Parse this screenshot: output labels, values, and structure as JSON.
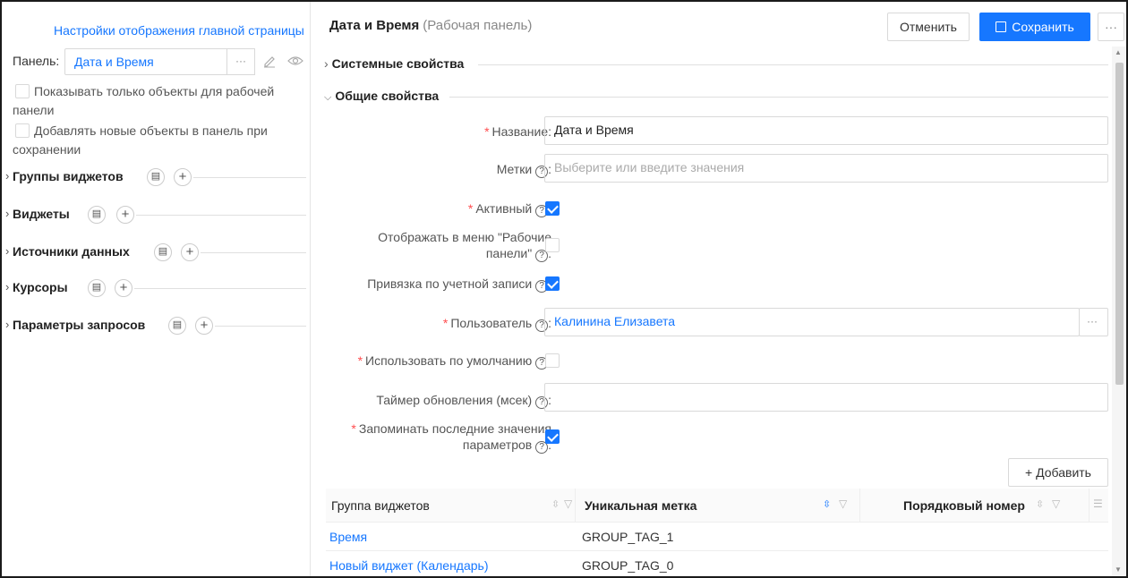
{
  "left": {
    "title": "Настройки отображения главной страницы",
    "panel_label": "Панель:",
    "panel_value": "Дата и Время",
    "panel_dots": "···",
    "options": [
      {
        "label": "Показывать только объекты для рабочей панели",
        "checked": false
      },
      {
        "label": "Добавлять новые объекты в панель при сохранении",
        "checked": false
      }
    ],
    "sections": [
      {
        "name": "Группы виджетов"
      },
      {
        "name": "Виджеты"
      },
      {
        "name": "Источники данных"
      },
      {
        "name": "Курсоры"
      },
      {
        "name": "Параметры запросов"
      }
    ]
  },
  "header": {
    "title": "Дата и Время",
    "subtitle": "(Рабочая панель)",
    "cancel_label": "Отменить",
    "save_label": "Сохранить",
    "more_label": "···"
  },
  "groups": {
    "system": "Системные свойства",
    "general": "Общие свойства"
  },
  "form": {
    "name_label": "Название:",
    "name_value": "Дата и Время",
    "tags_label": "Метки",
    "tags_placeholder": "Выберите или введите значения",
    "active_label": "Активный",
    "show_menu_label_1": "Отображать в меню \"Рабочие",
    "show_menu_label_2": "панели\"",
    "bind_account_label": "Привязка по учетной записи",
    "user_label": "Пользователь",
    "user_value": "Калинина Елизавета",
    "user_dots": "···",
    "default_label": "Использовать по умолчанию",
    "timer_label": "Таймер обновления (мсек)",
    "remember_label_1": "Запоминать последние значения",
    "remember_label_2": "параметров",
    "colon": ":",
    "qm": "?"
  },
  "table": {
    "add_label": "+ Добавить",
    "columns": [
      "Группа виджетов",
      "Уникальная метка",
      "Порядковый номер"
    ],
    "rows": [
      {
        "group": "Время",
        "tag": "GROUP_TAG_1",
        "order": ""
      },
      {
        "group": "Новый виджет (Календарь)",
        "tag": "GROUP_TAG_0",
        "order": ""
      }
    ]
  },
  "colors": {
    "accent": "#1677ff",
    "required": "#ff4d4f"
  }
}
